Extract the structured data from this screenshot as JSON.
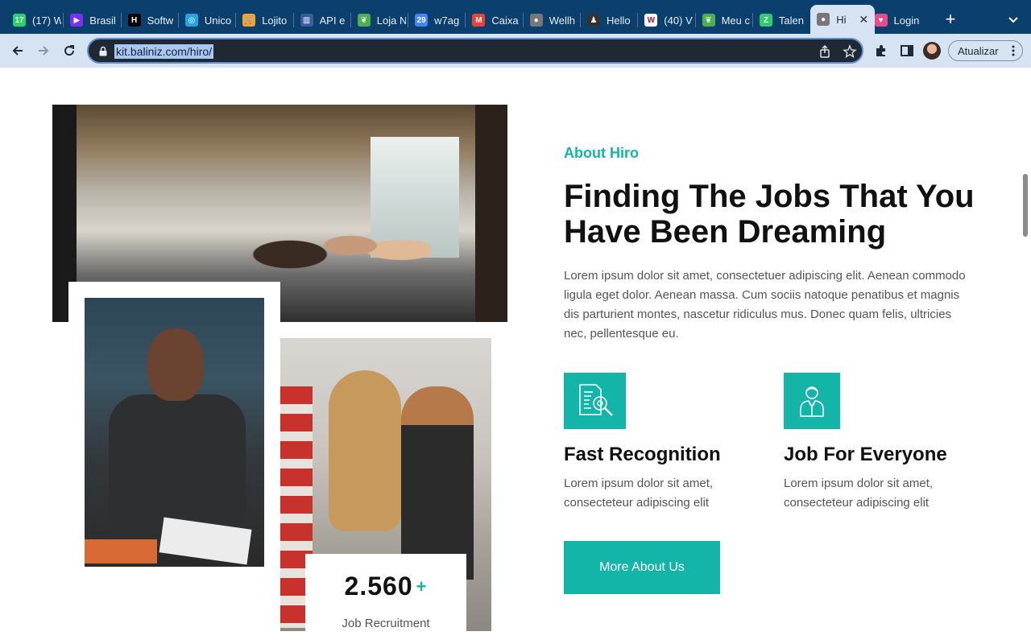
{
  "browser": {
    "tabs": [
      {
        "title": "(17) W",
        "icon": "whatsapp-icon",
        "color": "#25d366",
        "glyph": "17"
      },
      {
        "title": "Brasil",
        "icon": "play-icon",
        "color": "#7b2ff7",
        "glyph": "▶"
      },
      {
        "title": "Softw",
        "icon": "h-logo-icon",
        "color": "#000000",
        "glyph": "H"
      },
      {
        "title": "Unico",
        "icon": "crosshair-icon",
        "color": "#29a3e0",
        "glyph": "◎"
      },
      {
        "title": "Lojito",
        "icon": "cart-icon",
        "color": "#f2a22e",
        "glyph": "🛒"
      },
      {
        "title": "API e",
        "icon": "city-icon",
        "color": "#3a5ba0",
        "glyph": "▥"
      },
      {
        "title": "Loja N",
        "icon": "leaf-icon",
        "color": "#4caf50",
        "glyph": "❦"
      },
      {
        "title": "w7ag",
        "icon": "calendar-icon",
        "color": "#4285f4",
        "glyph": "29"
      },
      {
        "title": "Caixa",
        "icon": "gmail-icon",
        "color": "#ea4335",
        "glyph": "M"
      },
      {
        "title": "Wellh",
        "icon": "globe-icon",
        "color": "#777777",
        "glyph": "●"
      },
      {
        "title": "Hello",
        "icon": "person-icon",
        "color": "#333333",
        "glyph": "♟"
      },
      {
        "title": "(40) V",
        "icon": "w-logo-icon",
        "color": "#ffffff",
        "glyph": "W"
      },
      {
        "title": "Meu c",
        "icon": "leaf-icon",
        "color": "#4caf50",
        "glyph": "❦"
      },
      {
        "title": "Talen",
        "icon": "z-logo-icon",
        "color": "#2ecc71",
        "glyph": "Z"
      },
      {
        "title": "Hi",
        "icon": "globe-icon",
        "color": "#777777",
        "glyph": "●"
      },
      {
        "title": "Login",
        "icon": "heart-icon",
        "color": "#e74c8c",
        "glyph": "♥"
      }
    ],
    "url": "kit.baliniz.com/hiro/",
    "update_label": "Atualizar"
  },
  "about": {
    "eyebrow": "About Hiro",
    "headline": "Finding The Jobs That You Have Been Dreaming",
    "intro": "Lorem ipsum dolor sit amet, consectetuer adipiscing elit. Aenean commodo ligula eget dolor. Aenean massa. Cum sociis natoque penatibus et magnis dis parturient montes, nascetur ridiculus mus. Donec quam felis, ultricies nec, pellentesque eu.",
    "features": [
      {
        "title": "Fast Recognition",
        "desc": "Lorem ipsum dolor sit amet, consecteteur adipiscing elit",
        "icon": "document-search-icon"
      },
      {
        "title": "Job For Everyone",
        "desc": "Lorem ipsum dolor sit amet, consecteteur adipiscing elit",
        "icon": "employee-icon"
      }
    ],
    "cta_label": "More About Us"
  },
  "stat": {
    "number": "2.560",
    "plus": "+",
    "label": "Job Recruitment"
  },
  "colors": {
    "accent": "#12b5a8",
    "tabbar": "#0b3f6e",
    "toolbar": "#d6e3f2"
  }
}
